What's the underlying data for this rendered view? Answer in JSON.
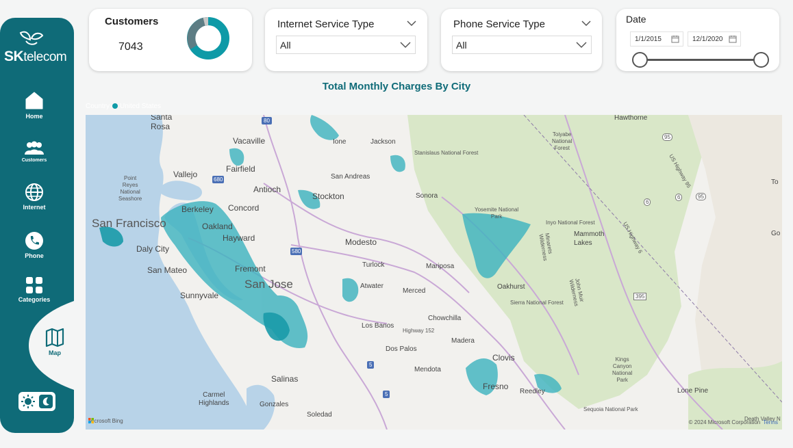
{
  "brand": {
    "logo_strong": "SK",
    "logo_light": "telecom"
  },
  "sidebar": {
    "items": [
      {
        "label": "Home",
        "icon": "home-icon"
      },
      {
        "label": "Customers",
        "icon": "users-icon"
      },
      {
        "label": "Internet",
        "icon": "globe-icon"
      },
      {
        "label": "Phone",
        "icon": "phone-icon"
      },
      {
        "label": "Categories",
        "icon": "grid-icon"
      },
      {
        "label": "Map",
        "icon": "map-icon",
        "active": true
      }
    ],
    "theme_toggle": {
      "icons": [
        "sun-icon",
        "moon-icon"
      ]
    }
  },
  "kpi": {
    "label": "Customers",
    "value": "7043"
  },
  "internet_slicer": {
    "title": "Internet Service Type",
    "value": "All"
  },
  "phone_slicer": {
    "title": "Phone Service Type",
    "value": "All"
  },
  "date_slicer": {
    "title": "Date",
    "start": "1/1/2015",
    "end": "12/1/2020"
  },
  "map": {
    "title": "Total Monthly Charges By City",
    "legend_field": "Country",
    "legend_item": "United States",
    "labels": {
      "santa_rosa": "Santa\nRosa",
      "vacaville": "Vacaville",
      "fairfield": "Fairfield",
      "vallejo": "Vallejo",
      "point_reyes": "Point\nReyes\nNational\nSeashore",
      "antioch": "Antioch",
      "berkeley": "Berkeley",
      "concord": "Concord",
      "oakland": "Oakland",
      "san_francisco": "San Francisco",
      "hayward": "Hayward",
      "daly_city": "Daly City",
      "fremont": "Fremont",
      "san_mateo": "San Mateo",
      "san_jose": "San Jose",
      "sunnyvale": "Sunnyvale",
      "ione": "Ione",
      "jackson": "Jackson",
      "stanislaus": "Stanislaus National Forest",
      "san_andreas": "San Andreas",
      "stockton": "Stockton",
      "sonora": "Sonora",
      "modesto": "Modesto",
      "turlock": "Turlock",
      "atwater": "Atwater",
      "merced": "Merced",
      "mariposa": "Mariposa",
      "yosemite": "Yosemite National\nPark",
      "chowchilla": "Chowchilla",
      "los_banos": "Los Banos",
      "highway_152": "Highway 152",
      "madera": "Madera",
      "dos_palos": "Dos Palos",
      "mendota": "Mendota",
      "clovis": "Clovis",
      "fresno": "Fresno",
      "reedley": "Reedley",
      "salinas": "Salinas",
      "carmel": "Carmel\nHighlands",
      "gonzales": "Gonzales",
      "soledad": "Soledad",
      "oakhurst": "Oakhurst",
      "sierra_nf": "Sierra National Forest",
      "inyo_nf": "Inyo National Forest",
      "mammoth": "Mammoth\nLakes",
      "hawthorne": "Hawthorne",
      "toiyabe": "Toiyabe\nNational\nForest",
      "lone_pine": "Lone Pine",
      "kings_canyon": "Kings\nCanyon\nNational\nPark",
      "sequoia": "Sequoia National Park",
      "death_valley": "Death Valley N",
      "john_muir": "John Muir\nWilderness",
      "minarets": "Minarets\nWilderness",
      "us_highway_95": "US Highway 95",
      "us_highway_6": "US Highway 6",
      "to": "To",
      "go": "Go",
      "shield_80": "80",
      "shield_680": "680",
      "shield_580": "580",
      "shield_5a": "5",
      "shield_5b": "5",
      "shield_395": "395",
      "shield_95": "95",
      "shield_6": "6",
      "shield_95b": "95",
      "shield_6b": "6"
    },
    "bing": "Microsoft Bing",
    "attribution": "© 2024 Microsoft Corporation",
    "terms": "Terms"
  },
  "colors": {
    "primary": "#0f6b78",
    "region_fill": "#3fb3bf",
    "region_dark": "#1a9aa8",
    "forest": "#d9e7c8",
    "water": "#b8d3e8"
  }
}
